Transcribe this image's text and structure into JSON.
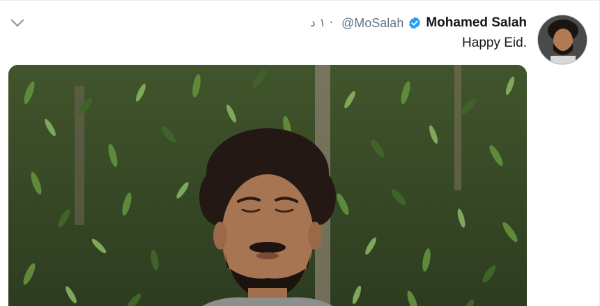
{
  "tweet": {
    "display_name": "Mohamed Salah",
    "handle": "@MoSalah",
    "timestamp": "١ د ·",
    "text": "Happy Eid.",
    "verified_icon": "verified-badge-icon",
    "menu_icon": "chevron-down-icon"
  },
  "colors": {
    "name": "#14171a",
    "secondary": "#657786",
    "verified": "#1da1f2",
    "border": "#e6ecf0"
  }
}
